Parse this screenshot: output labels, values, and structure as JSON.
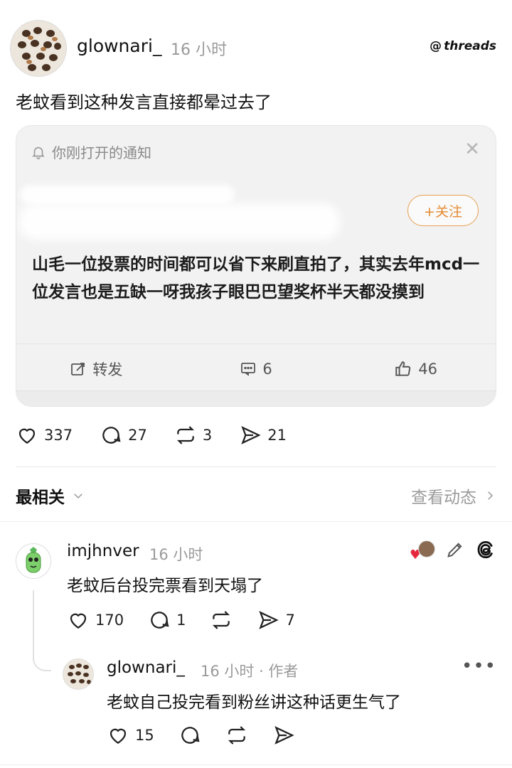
{
  "post": {
    "username": "glownari_",
    "time": "16 小时",
    "brand": "threads",
    "text": "老蚊看到这种发言直接都晕过去了",
    "stats": {
      "likes": "337",
      "comments": "27",
      "reposts": "3",
      "shares": "21"
    }
  },
  "embedded_card": {
    "header": "你刚打开的通知",
    "follow_label": "+关注",
    "body": "山毛一位投票的时间都可以省下来刷直拍了，其实去年mcd一位发言也是五缺一呀我孩子眼巴巴望奖杯半天都没摸到",
    "actions": {
      "repost_label": "转发",
      "comments": "6",
      "likes": "46"
    }
  },
  "sort": {
    "label": "最相关",
    "view_activity": "查看动态"
  },
  "replies": [
    {
      "username": "imjhnver",
      "time": "16 小时",
      "text": "老蚊后台投完票看到天塌了",
      "stats": {
        "likes": "170",
        "comments": "1",
        "shares": "7"
      }
    },
    {
      "username": "glownari_",
      "time": "16 小时 · 作者",
      "text": "老蚊自己投完看到粉丝讲这种话更生气了",
      "stats": {
        "likes": "15"
      }
    }
  ],
  "colors": {
    "accent_follow": "#e58b32",
    "muted": "#9a9a9a",
    "heart": "#e5283d"
  }
}
